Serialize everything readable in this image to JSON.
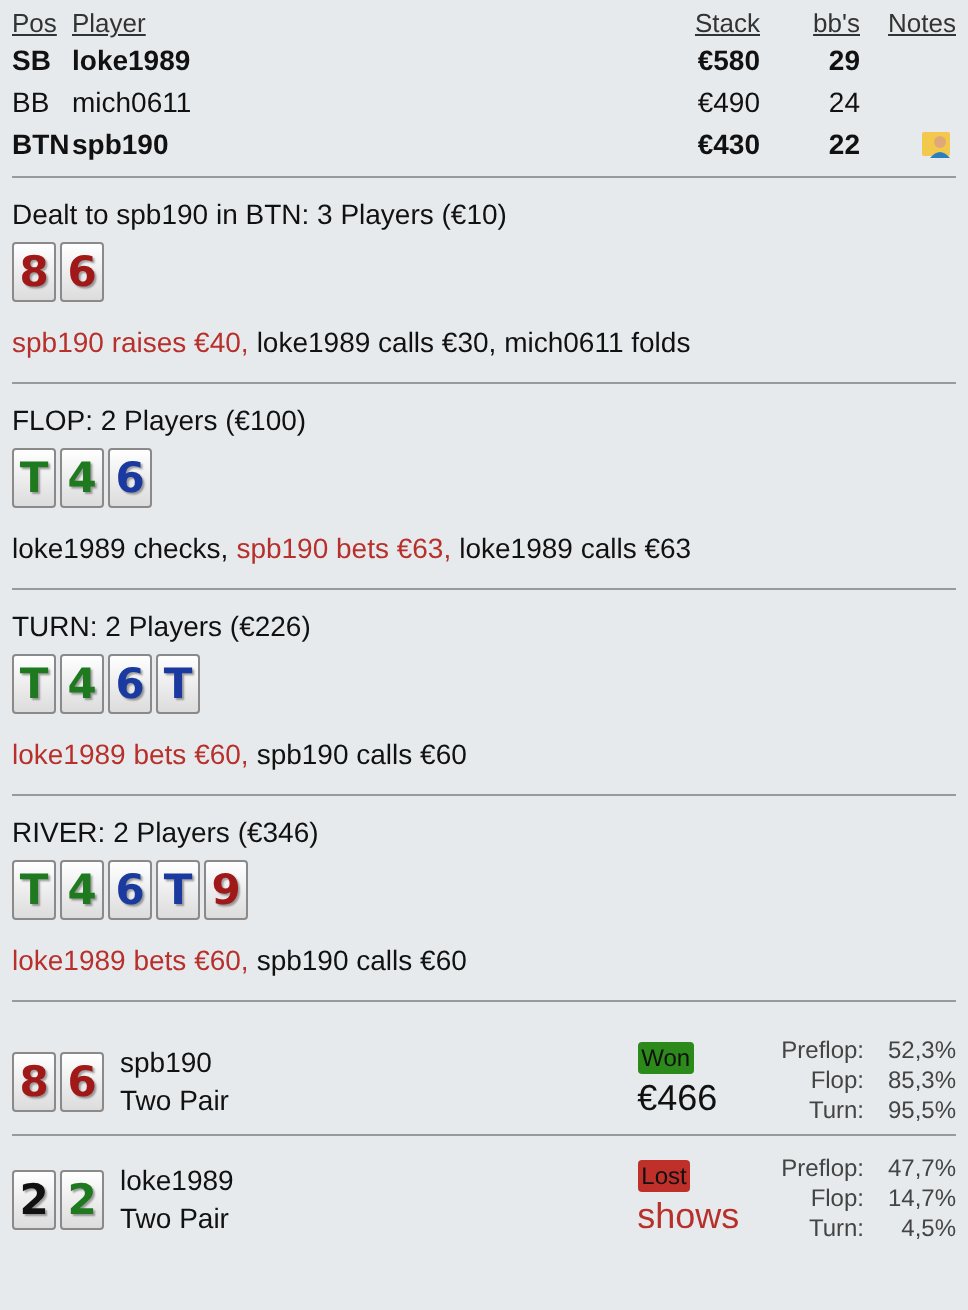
{
  "players_table": {
    "columns": [
      "Pos",
      "Player",
      "Stack",
      "bb's",
      "Notes"
    ],
    "rows": [
      {
        "pos": "SB",
        "player": "loke1989",
        "stack": "€580",
        "bbs": "29",
        "bold": true,
        "has_note": false
      },
      {
        "pos": "BB",
        "player": "mich0611",
        "stack": "€490",
        "bbs": "24",
        "bold": false,
        "has_note": false
      },
      {
        "pos": "BTN",
        "player": "spb190",
        "stack": "€430",
        "bbs": "22",
        "bold": true,
        "has_note": true
      }
    ]
  },
  "streets": [
    {
      "title": "Dealt to spb190 in BTN: 3 Players (€10)",
      "cards": [
        {
          "rank": "8",
          "color": "#a01818"
        },
        {
          "rank": "6",
          "color": "#a01818"
        }
      ],
      "actions": [
        {
          "text": "spb190 raises €40,",
          "highlight": true
        },
        {
          "text": "loke1989 calls €30, mich0611 folds",
          "highlight": false
        }
      ]
    },
    {
      "title": "FLOP: 2 Players (€100)",
      "cards": [
        {
          "rank": "T",
          "color": "#1f7a1f"
        },
        {
          "rank": "4",
          "color": "#1f7a1f"
        },
        {
          "rank": "6",
          "color": "#1a3aa0"
        }
      ],
      "actions": [
        {
          "text": "loke1989 checks,",
          "highlight": false
        },
        {
          "text": "spb190 bets €63,",
          "highlight": true
        },
        {
          "text": "loke1989 calls €63",
          "highlight": false
        }
      ]
    },
    {
      "title": "TURN: 2 Players (€226)",
      "cards": [
        {
          "rank": "T",
          "color": "#1f7a1f"
        },
        {
          "rank": "4",
          "color": "#1f7a1f"
        },
        {
          "rank": "6",
          "color": "#1a3aa0"
        },
        {
          "rank": "T",
          "color": "#1a3aa0"
        }
      ],
      "actions": [
        {
          "text": "loke1989 bets €60,",
          "highlight": true
        },
        {
          "text": "spb190 calls €60",
          "highlight": false
        }
      ]
    },
    {
      "title": "RIVER: 2 Players (€346)",
      "cards": [
        {
          "rank": "T",
          "color": "#1f7a1f"
        },
        {
          "rank": "4",
          "color": "#1f7a1f"
        },
        {
          "rank": "6",
          "color": "#1a3aa0"
        },
        {
          "rank": "T",
          "color": "#1a3aa0"
        },
        {
          "rank": "9",
          "color": "#a01818"
        }
      ],
      "actions": [
        {
          "text": "loke1989 bets €60,",
          "highlight": true
        },
        {
          "text": "spb190 calls €60",
          "highlight": false
        }
      ]
    }
  ],
  "results": [
    {
      "cards": [
        {
          "rank": "8",
          "color": "#a01818"
        },
        {
          "rank": "6",
          "color": "#a01818"
        }
      ],
      "player": "spb190",
      "hand": "Two Pair",
      "kind": "won",
      "badge": "Won",
      "amount": "€466",
      "equity": [
        {
          "label": "Preflop:",
          "value": "52,3%"
        },
        {
          "label": "Flop:",
          "value": "85,3%"
        },
        {
          "label": "Turn:",
          "value": "95,5%"
        }
      ]
    },
    {
      "cards": [
        {
          "rank": "2",
          "color": "#111111"
        },
        {
          "rank": "2",
          "color": "#1f7a1f"
        }
      ],
      "player": "loke1989",
      "hand": "Two Pair",
      "kind": "lost",
      "badge": "Lost",
      "amount": "shows",
      "equity": [
        {
          "label": "Preflop:",
          "value": "47,7%"
        },
        {
          "label": "Flop:",
          "value": "14,7%"
        },
        {
          "label": "Turn:",
          "value": "4,5%"
        }
      ]
    }
  ]
}
